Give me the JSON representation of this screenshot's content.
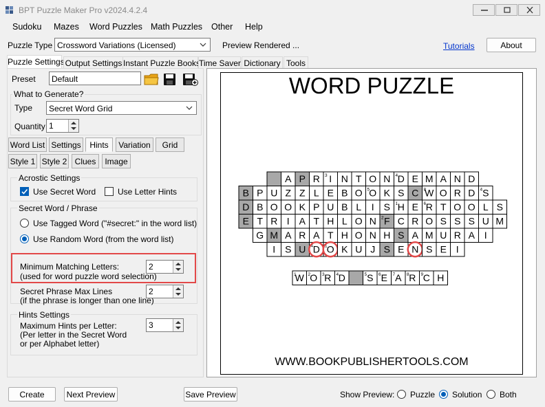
{
  "window": {
    "title": "BPT Puzzle Maker Pro v2024.4.2.4"
  },
  "menu": [
    "Sudoku",
    "Mazes",
    "Word Puzzles",
    "Math Puzzles",
    "Other",
    "Help"
  ],
  "toolbar": {
    "puzzle_type_label": "Puzzle Type",
    "puzzle_type_value": "Crossword Variations (Licensed)",
    "status": "Preview Rendered ...",
    "tutorials_link": "Tutorials",
    "about_button": "About"
  },
  "tabs": [
    "Puzzle Settings",
    "Output Settings",
    "Instant Puzzle Books",
    "Time Saver",
    "Dictionary",
    "Tools"
  ],
  "settings": {
    "preset_label": "Preset",
    "preset_value": "Default",
    "what_to_generate": "What to Generate?",
    "type_label": "Type",
    "type_value": "Secret Word Grid",
    "quantity_label": "Quantity",
    "quantity_value": "1",
    "subtabs_row1": [
      "Word List",
      "Settings",
      "Hints",
      "Variation",
      "Grid"
    ],
    "subtabs_row2": [
      "Style 1",
      "Style 2",
      "Clues",
      "Image"
    ],
    "acrostic_title": "Acrostic Settings",
    "use_secret_word": "Use Secret Word",
    "use_letter_hints": "Use Letter Hints",
    "secret_phrase_title": "Secret Word / Phrase",
    "use_tagged_word": "Use Tagged Word (\"#secret:\" in the word list)",
    "use_random_word": "Use Random Word (from the word list)",
    "min_matching_label1": "Minimum Matching Letters:",
    "min_matching_label2": "(used for word puzzle word selection)",
    "min_matching_value": "2",
    "max_lines_label1": "Secret Phrase Max Lines",
    "max_lines_label2": "(if the phrase is longer than one line)",
    "max_lines_value": "2",
    "hints_title": "Hints Settings",
    "max_hints_label1": "Maximum Hints per Letter:",
    "max_hints_label2": "(Per letter in the Secret Word",
    "max_hints_label3": "or per Alphabet letter)",
    "max_hints_value": "3"
  },
  "preview": {
    "title": "WORD PUZZLE",
    "footer": "WWW.BOOKPUBLISHERTOOLS.COM",
    "grid_rows": [
      {
        "start": 2,
        "cells": [
          "#",
          "A",
          "P",
          "R",
          "I",
          "N",
          "T",
          "O",
          "N",
          "D",
          "E",
          "M",
          "A",
          "N",
          "D"
        ],
        "nums": {
          "4": "3",
          "9": "4"
        }
      },
      {
        "start": 0,
        "cells": [
          "B",
          "P",
          "U",
          "Z",
          "Z",
          "L",
          "E",
          "B",
          "O",
          "O",
          "K",
          "S",
          "C",
          "W",
          "O",
          "R",
          "D",
          "S"
        ],
        "nums": {
          "9": "5",
          "13": "8",
          "17": "4"
        }
      },
      {
        "start": 0,
        "cells": [
          "D",
          "B",
          "O",
          "O",
          "K",
          "P",
          "U",
          "B",
          "L",
          "I",
          "S",
          "H",
          "E",
          "R",
          "T",
          "O",
          "O",
          "L",
          "S"
        ],
        "nums": {
          "11": "1",
          "13": "6"
        }
      },
      {
        "start": 0,
        "cells": [
          "E",
          "T",
          "R",
          "I",
          "A",
          "T",
          "H",
          "L",
          "O",
          "N",
          "F",
          "C",
          "R",
          "O",
          "S",
          "S",
          "S",
          "U",
          "M"
        ],
        "nums": {
          "10": "2"
        }
      },
      {
        "start": 1,
        "cells": [
          "G",
          "M",
          "A",
          "R",
          "A",
          "T",
          "H",
          "O",
          "N",
          "H",
          "S",
          "A",
          "M",
          "U",
          "R",
          "A",
          "I"
        ],
        "nums": {}
      },
      {
        "start": 2,
        "cells": [
          "I",
          "S",
          "U",
          "D",
          "O",
          "K",
          "U",
          "J",
          "S",
          "E",
          "N",
          "S",
          "E",
          "I"
        ],
        "nums": {
          "3": "4",
          "4": "1"
        }
      }
    ],
    "shaded": [
      "0-2",
      "1-0",
      "1-12",
      "2-0",
      "3-0",
      "3-10",
      "4-1",
      "4-10",
      "5-2",
      "5-8"
    ],
    "circles": [
      "5-3",
      "5-4",
      "5-10",
      "5-14"
    ],
    "secret": [
      "W",
      "O",
      "R",
      "D",
      "#",
      "S",
      "E",
      "A",
      "R",
      "C",
      "H"
    ],
    "secret_nums": [
      "1",
      "2",
      "3",
      "4",
      "",
      "5",
      "6",
      "7",
      "8",
      "9",
      ""
    ]
  },
  "bottom": {
    "create": "Create",
    "next_preview": "Next Preview",
    "save_preview": "Save Preview",
    "show_preview": "Show Preview:",
    "opt_puzzle": "Puzzle",
    "opt_solution": "Solution",
    "opt_both": "Both"
  }
}
